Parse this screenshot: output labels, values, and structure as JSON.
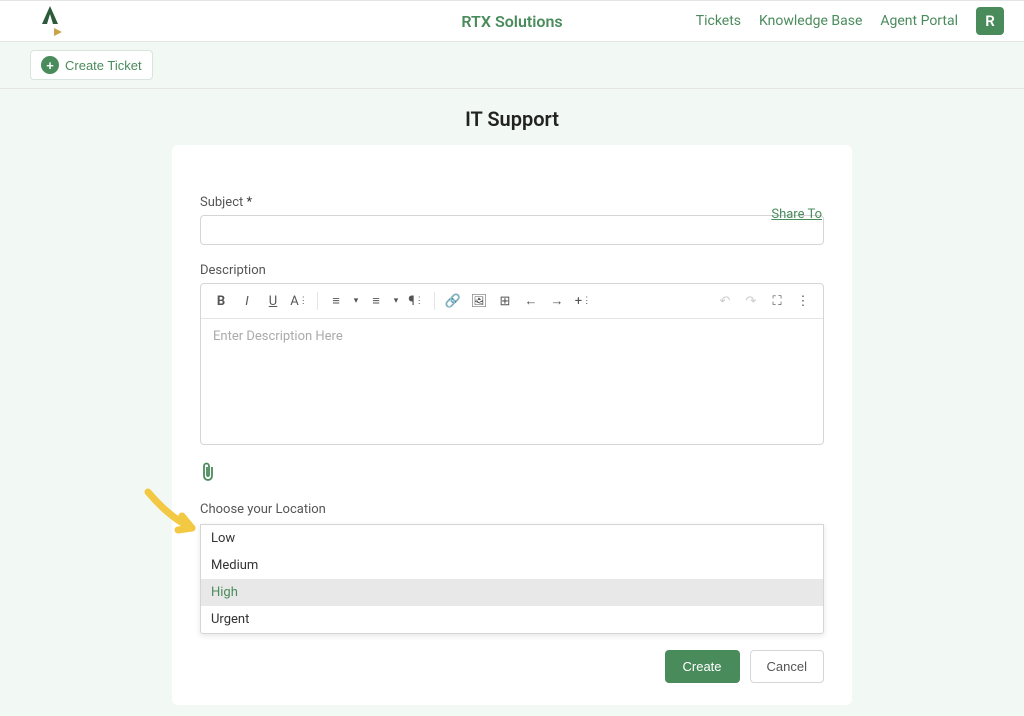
{
  "header": {
    "brand": "RTX Solutions",
    "nav": {
      "tickets": "Tickets",
      "kb": "Knowledge Base",
      "agent": "Agent Portal"
    },
    "avatar_initial": "R"
  },
  "subbar": {
    "create_ticket": "Create Ticket"
  },
  "page": {
    "title": "IT Support"
  },
  "form": {
    "share": "Share To",
    "subject_label": "Subject",
    "required_mark": "*",
    "description_label": "Description",
    "description_placeholder": "Enter Description Here",
    "location_label": "Choose your Location",
    "priority_options": [
      "Low",
      "Medium",
      "High",
      "Urgent"
    ],
    "create_btn": "Create",
    "cancel_btn": "Cancel"
  },
  "toolbar_icons": {
    "bold": "B",
    "italic": "I",
    "underline": "U",
    "font": "A",
    "olist": "≡",
    "olist_caret": "▾",
    "ulist": "≡",
    "ulist_caret": "▾",
    "para": "¶",
    "link": "🔗",
    "image": "🖼",
    "table": "⊞",
    "back": "←",
    "forward": "→",
    "more1": "+",
    "undo": "↶",
    "redo": "↷",
    "expand": "⛶",
    "menu": "⋮"
  }
}
